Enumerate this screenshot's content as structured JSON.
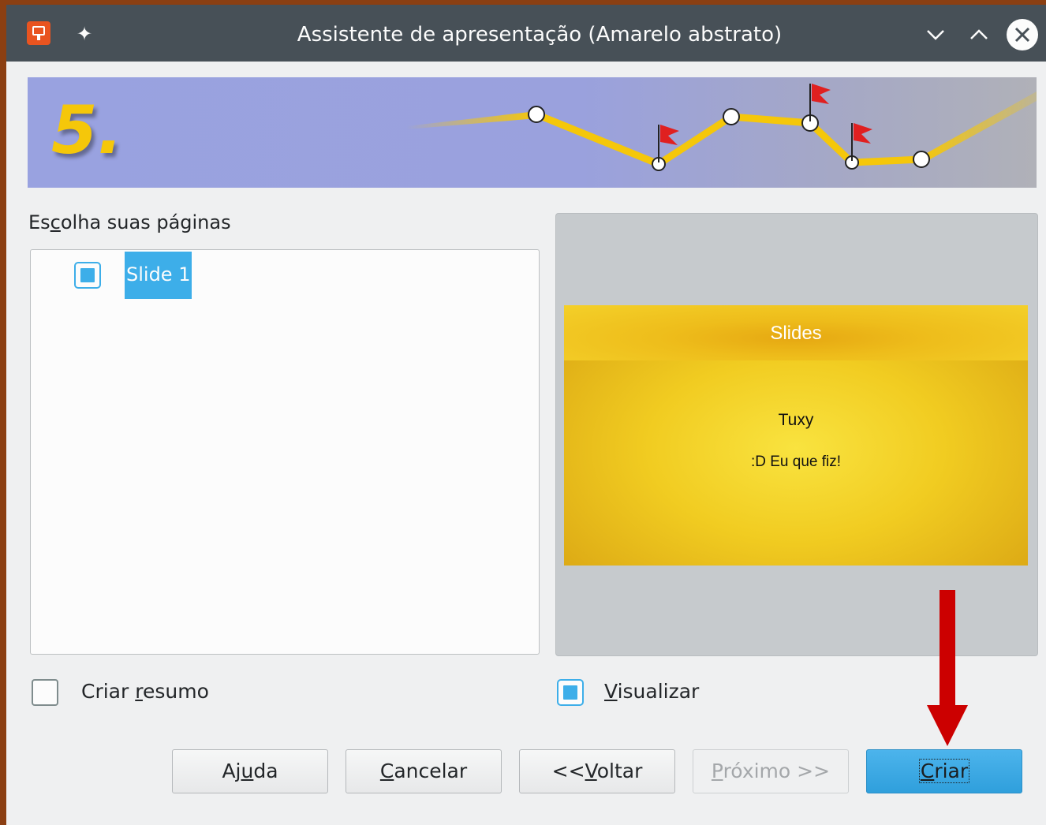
{
  "window": {
    "title": "Assistente de apresentação (Amarelo abstrato)",
    "controls": {
      "minimize_icon": "chevron-down-icon",
      "maximize_icon": "chevron-up-icon",
      "close_icon": "close-icon"
    }
  },
  "banner": {
    "step_number": "5."
  },
  "pages": {
    "label_pre": "Es",
    "label_accel": "c",
    "label_post": "olha suas páginas",
    "items": [
      {
        "label": "Slide 1",
        "checked": true,
        "selected": true
      }
    ]
  },
  "preview": {
    "slide_title": "Slides",
    "line1": "Tuxy",
    "line2": ":D Eu que fiz!"
  },
  "options": {
    "summary": {
      "pre": "Criar ",
      "accel": "r",
      "post": "esumo",
      "checked": false
    },
    "preview": {
      "pre": "",
      "accel": "V",
      "post": "isualizar",
      "checked": true
    }
  },
  "buttons": {
    "help": {
      "pre": "Aj",
      "accel": "u",
      "post": "da"
    },
    "cancel": {
      "pre": "",
      "accel": "C",
      "post": "ancelar"
    },
    "back": {
      "pre": "<<",
      "accel": "V",
      "post": "oltar"
    },
    "next": {
      "pre": "",
      "accel": "P",
      "post": "róximo >>",
      "enabled": false
    },
    "create": {
      "pre": "",
      "accel": "C",
      "post": "riar",
      "focused": true
    }
  },
  "colors": {
    "accent": "#3daee9",
    "titlebar": "#475057",
    "annotation_arrow": "#cc0000"
  }
}
